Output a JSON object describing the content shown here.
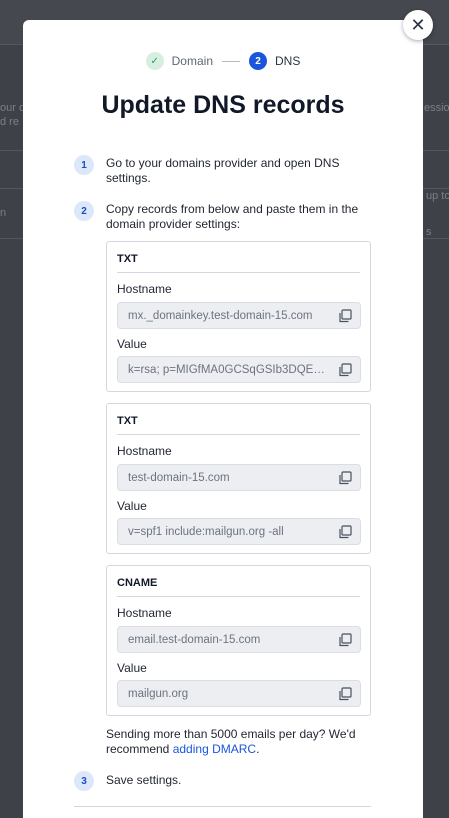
{
  "background": {
    "fragments": [
      "our c",
      "d re",
      "essio",
      "n",
      "up to",
      "s"
    ]
  },
  "stepper": {
    "steps": [
      {
        "number": "✓",
        "label": "Domain",
        "state": "done"
      },
      {
        "number": "2",
        "label": "DNS",
        "state": "active"
      }
    ]
  },
  "title": "Update DNS records",
  "instructions": [
    {
      "number": "1",
      "text": "Go to your domains provider and open DNS settings."
    },
    {
      "number": "2",
      "text": "Copy records from below and paste them in the domain provider settings:"
    },
    {
      "number": "3",
      "text": "Save settings."
    }
  ],
  "records": [
    {
      "type": "TXT",
      "hostname_label": "Hostname",
      "hostname": "mx._domainkey.test-domain-15.com",
      "value_label": "Value",
      "value": "k=rsa; p=MIGfMA0GCSqGSIb3DQEBA…"
    },
    {
      "type": "TXT",
      "hostname_label": "Hostname",
      "hostname": "test-domain-15.com",
      "value_label": "Value",
      "value": "v=spf1 include:mailgun.org -all"
    },
    {
      "type": "CNAME",
      "hostname_label": "Hostname",
      "hostname": "email.test-domain-15.com",
      "value_label": "Value",
      "value": "mailgun.org"
    }
  ],
  "dmarc_note": {
    "text": "Sending more than 5000 emails per day? We'd recommend ",
    "link": "adding DMARC",
    "suffix": "."
  },
  "close_label": "✕",
  "colors": {
    "accent": "#1a56db",
    "done": "#2d9b5a"
  }
}
